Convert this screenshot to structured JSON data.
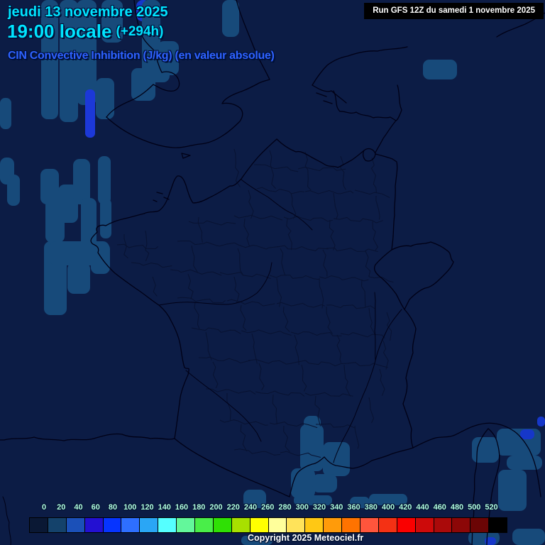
{
  "header": {
    "date_line": "jeudi 13 novembre 2025",
    "time_value": "19:00 locale",
    "forecast_offset": "(+294h)",
    "subtitle": "CIN Convective Inhibition (J/kg) (en valeur absolue)"
  },
  "run_box": {
    "text": "Run GFS 12Z du samedi 1 novembre 2025"
  },
  "footer": {
    "copyright": "Copyright 2025 Meteociel.fr"
  },
  "colors": {
    "background": "#0c1c45",
    "title_cyan": "#00e4ff",
    "subtitle_blue": "#2e62ff",
    "scale_label": "#b2ffdf",
    "coast_line": "#000016",
    "dept_line": "#081231"
  },
  "scale": {
    "unit": "J/kg",
    "labels": [
      "0",
      "20",
      "40",
      "60",
      "80",
      "100",
      "120",
      "140",
      "160",
      "180",
      "200",
      "220",
      "240",
      "260",
      "280",
      "300",
      "320",
      "340",
      "360",
      "380",
      "400",
      "420",
      "440",
      "460",
      "480",
      "500",
      "520"
    ],
    "colors": [
      "#0a1834",
      "#14426b",
      "#1b50b8",
      "#2310d2",
      "#0634ff",
      "#2e6fff",
      "#2aa6f5",
      "#55ffff",
      "#63f79b",
      "#49ee49",
      "#2fe005",
      "#a8e000",
      "#ffff00",
      "#ffff9b",
      "#ffe35a",
      "#ffc814",
      "#ff9b0a",
      "#ff7300",
      "#ff553c",
      "#f43114",
      "#fa0000",
      "#cd0a0a",
      "#aa0a0a",
      "#8c0707",
      "#6b0505",
      "#000000"
    ]
  },
  "map": {
    "palette": {
      "s": "#174a7a",
      "r": "#1637c9",
      "b": "#1c38d8"
    },
    "patches": [
      [
        58,
        0,
        24,
        168,
        "s"
      ],
      [
        84,
        0,
        26,
        172,
        "s"
      ],
      [
        108,
        0,
        28,
        148,
        "s"
      ],
      [
        143,
        0,
        30,
        60,
        "s"
      ],
      [
        192,
        0,
        20,
        30,
        "r"
      ],
      [
        200,
        0,
        26,
        112,
        "s"
      ],
      [
        222,
        58,
        30,
        48,
        "s"
      ],
      [
        203,
        88,
        36,
        28,
        "s"
      ],
      [
        313,
        0,
        24,
        52,
        "s"
      ],
      [
        185,
        96,
        34,
        46,
        "s"
      ],
      [
        135,
        110,
        26,
        58,
        "s"
      ],
      [
        120,
        126,
        14,
        68,
        "b"
      ],
      [
        0,
        138,
        16,
        44,
        "s"
      ],
      [
        0,
        222,
        20,
        38,
        "s"
      ],
      [
        10,
        246,
        18,
        44,
        "s"
      ],
      [
        57,
        238,
        26,
        50,
        "s"
      ],
      [
        64,
        280,
        27,
        62,
        "s"
      ],
      [
        82,
        260,
        28,
        54,
        "s"
      ],
      [
        103,
        224,
        24,
        64,
        "s"
      ],
      [
        114,
        279,
        22,
        72,
        "s"
      ],
      [
        138,
        220,
        18,
        68,
        "s"
      ],
      [
        141,
        280,
        16,
        56,
        "s"
      ],
      [
        62,
        340,
        32,
        104,
        "s"
      ],
      [
        70,
        340,
        84,
        34,
        "s"
      ],
      [
        95,
        370,
        32,
        44,
        "s"
      ],
      [
        128,
        342,
        27,
        44,
        "s"
      ],
      [
        596,
        84,
        48,
        28,
        "s"
      ],
      [
        428,
        586,
        24,
        26,
        "s"
      ],
      [
        423,
        598,
        33,
        66,
        "s"
      ],
      [
        455,
        623,
        38,
        48,
        "s"
      ],
      [
        410,
        660,
        34,
        42,
        "s"
      ],
      [
        440,
        668,
        35,
        26,
        "s"
      ],
      [
        343,
        690,
        32,
        26,
        "s"
      ],
      [
        414,
        698,
        54,
        14,
        "s"
      ],
      [
        520,
        696,
        54,
        16,
        "s"
      ],
      [
        493,
        700,
        28,
        16,
        "s"
      ],
      [
        665,
        616,
        38,
        36,
        "s"
      ],
      [
        700,
        604,
        62,
        38,
        "s"
      ],
      [
        714,
        642,
        50,
        20,
        "s"
      ],
      [
        702,
        662,
        40,
        58,
        "s"
      ],
      [
        733,
        605,
        20,
        14,
        "r"
      ],
      [
        757,
        587,
        11,
        14,
        "r"
      ],
      [
        660,
        748,
        44,
        20,
        "s"
      ],
      [
        722,
        745,
        46,
        23,
        "s"
      ],
      [
        683,
        757,
        16,
        11,
        "r"
      ],
      [
        340,
        755,
        44,
        13,
        "s"
      ]
    ]
  }
}
